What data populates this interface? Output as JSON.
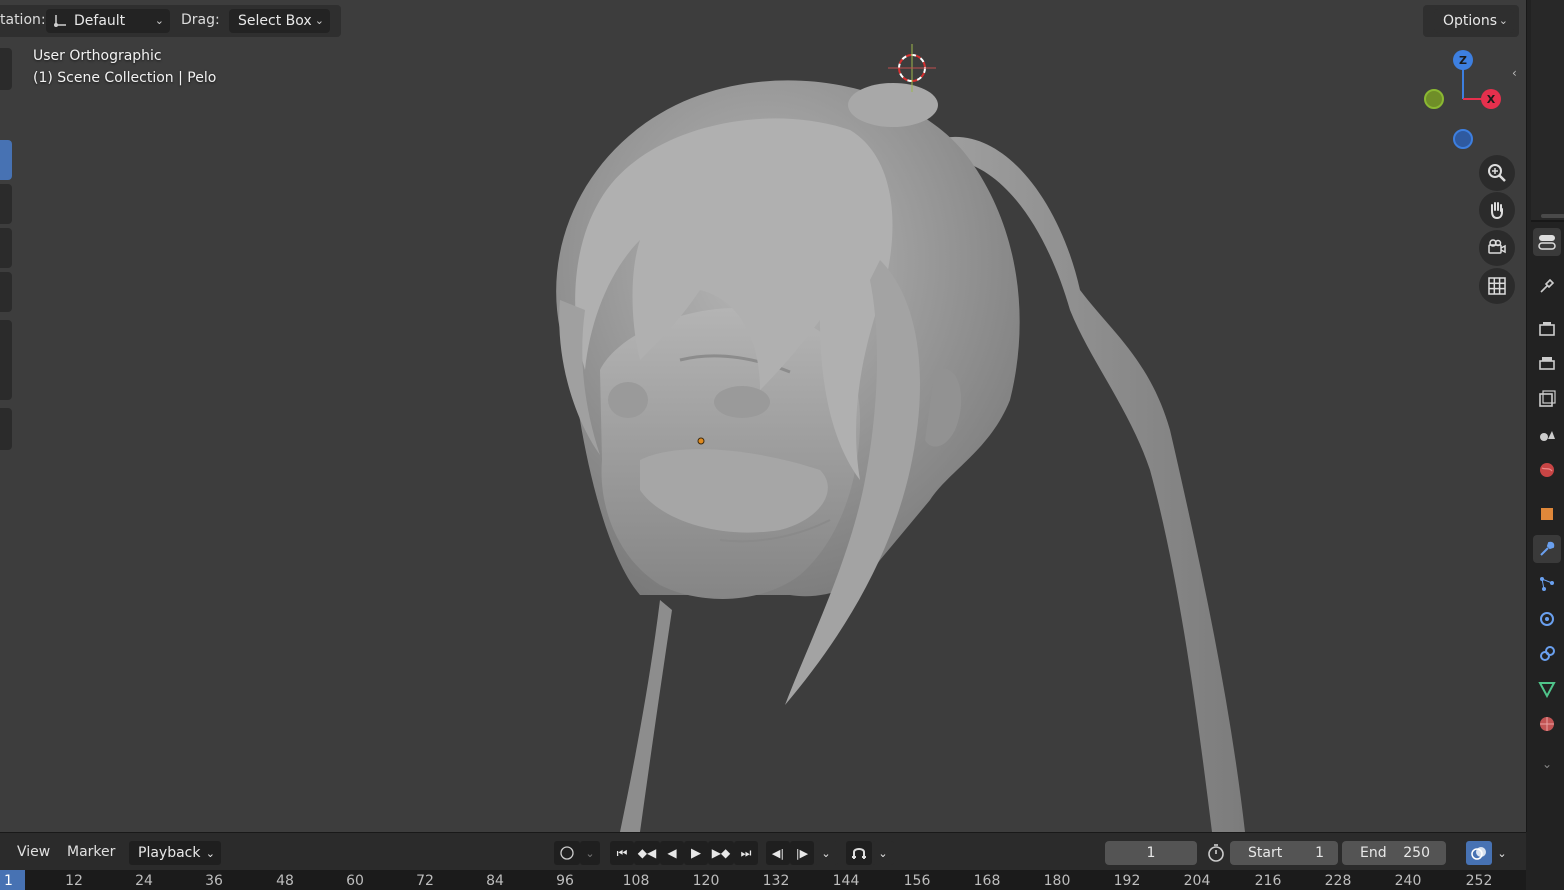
{
  "header": {
    "orientation_label": "tation:",
    "orientation_value": "Default",
    "drag_label": "Drag:",
    "drag_value": "Select Box",
    "options_label": "Options"
  },
  "viewport": {
    "view_name": "User Orthographic",
    "collection_info": "(1) Scene Collection | Pelo"
  },
  "gizmo": {
    "z": "Z",
    "x": "X"
  },
  "timeline": {
    "menus": [
      "View",
      "Marker",
      "Playback"
    ],
    "current_frame": "1",
    "start_label": "Start",
    "start_value": "1",
    "end_label": "End",
    "end_value": "250",
    "ruler_current": "1",
    "ticks": [
      "12",
      "24",
      "36",
      "48",
      "60",
      "72",
      "84",
      "96",
      "108",
      "120",
      "132",
      "144",
      "156",
      "168",
      "180",
      "192",
      "204",
      "216",
      "228",
      "240",
      "252"
    ]
  },
  "colors": {
    "accent": "#4772b3",
    "axis_x": "#e5304d",
    "axis_y": "#8ab832",
    "axis_z": "#3d7fe0",
    "viewport_bg": "#3d3d3d"
  }
}
